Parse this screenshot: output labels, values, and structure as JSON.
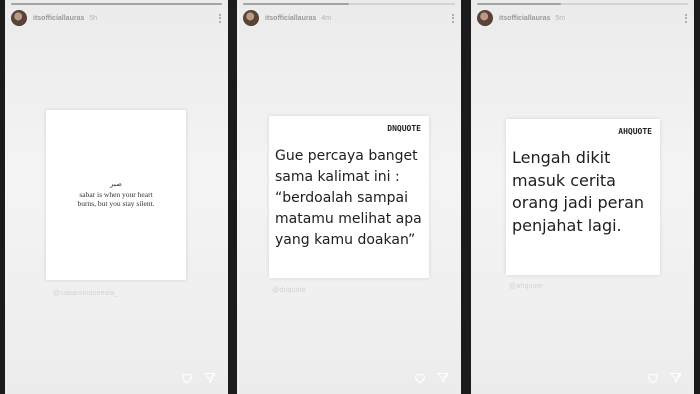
{
  "stories": [
    {
      "username": "itsofficiallauras",
      "time": "5h",
      "arabic": "صبر",
      "quote_lines": [
        "sabar is when your heart",
        "burns, but you stay silent."
      ],
      "mention": "@sabarsindonesia_"
    },
    {
      "username": "itsofficiallauras",
      "time": "4m",
      "brand": "DNQUOTE",
      "quote_lines": [
        "Gue percaya banget",
        "sama kalimat ini :",
        "“berdoalah sampai",
        "matamu melihat apa",
        "yang kamu doakan”"
      ],
      "mention": "@dnquote"
    },
    {
      "username": "itsofficiallauras",
      "time": "5m",
      "brand": "AHQUOTE",
      "quote_lines": [
        "Lengah dikit",
        "masuk cerita",
        "orang jadi peran",
        "penjahat lagi."
      ],
      "mention": "@ahquote"
    }
  ],
  "progress": [
    1.0,
    0.5,
    0.4
  ],
  "icons": {
    "heart": "heart-icon",
    "send": "send-icon",
    "more": "more-options-icon",
    "avatar": "profile-avatar"
  }
}
